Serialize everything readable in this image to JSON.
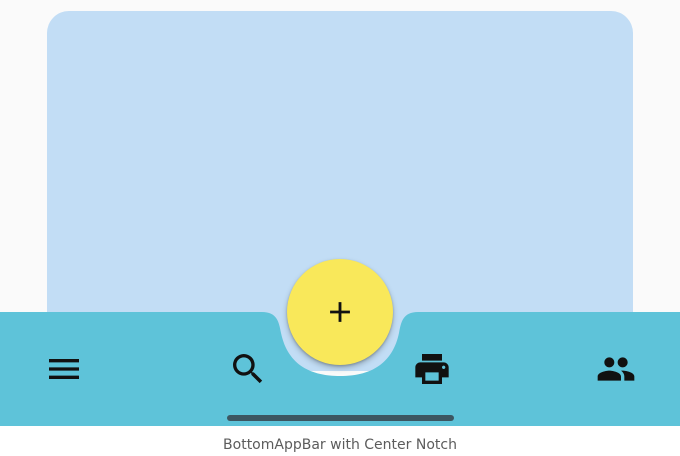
{
  "colors": {
    "screen_background": "#fafafa",
    "content_card": "#c2ddf5",
    "bottom_app_bar": "#5ec3d9",
    "fab": "#f9e85a",
    "icon": "#111111",
    "home_indicator": "#3c5661"
  },
  "bottom_app_bar": {
    "actions": [
      {
        "icon": "menu-icon"
      },
      {
        "icon": "search-icon"
      },
      {
        "icon": "print-icon"
      },
      {
        "icon": "people-icon"
      }
    ],
    "notch": "center"
  },
  "fab": {
    "icon": "add-icon"
  },
  "caption": "BottomAppBar with Center Notch"
}
